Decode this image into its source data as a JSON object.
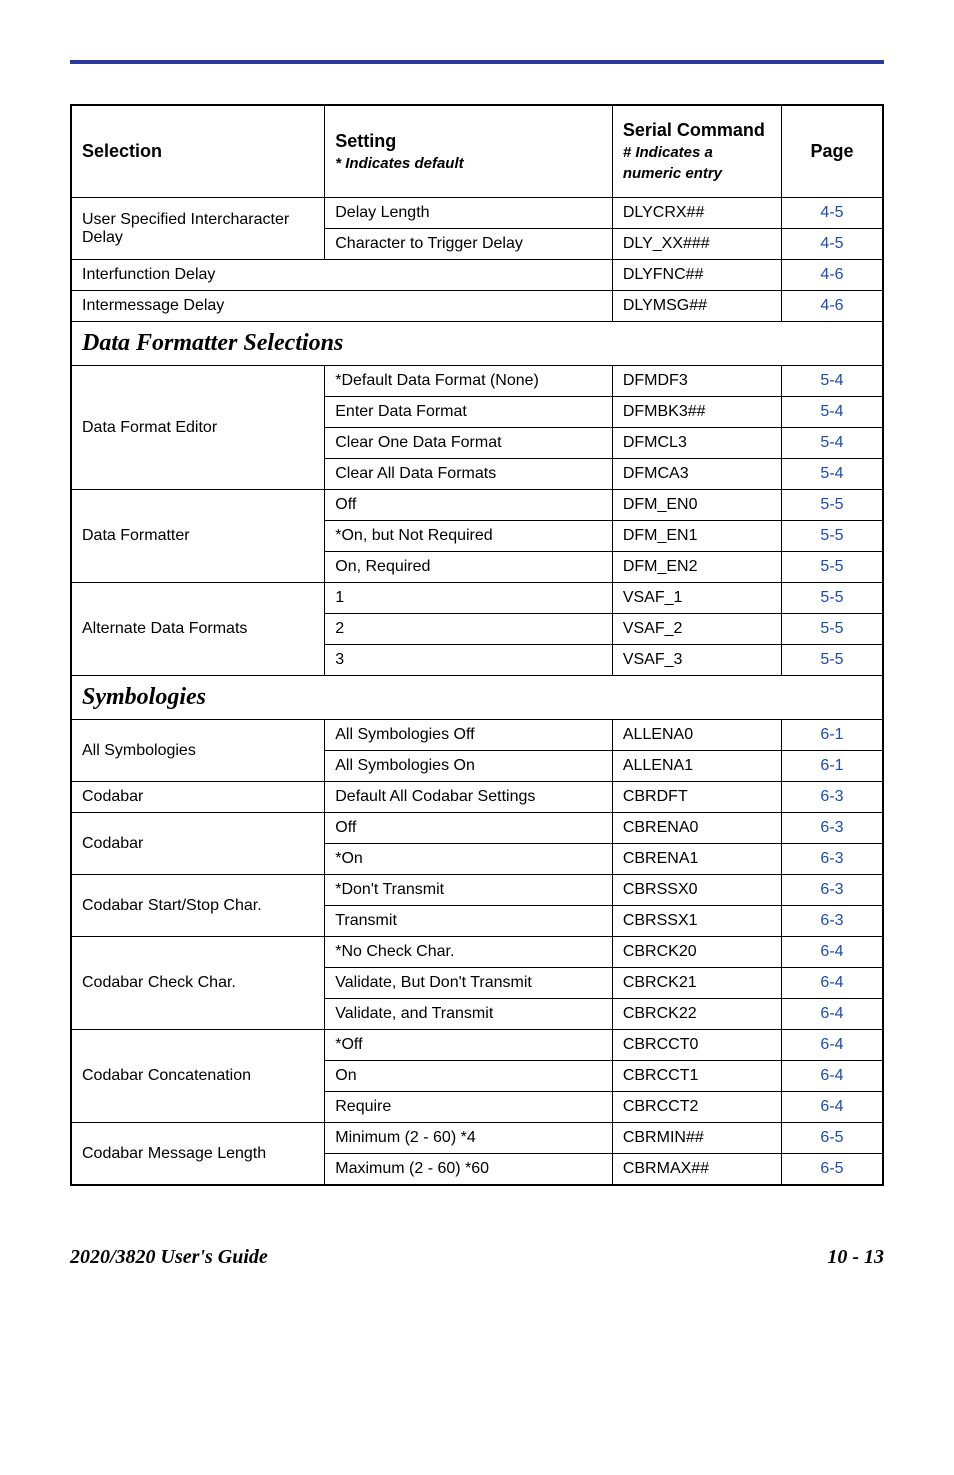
{
  "header": {
    "selection": "Selection",
    "setting": "Setting",
    "setting_sub": "* Indicates default",
    "serial": "Serial Command",
    "serial_sub": "# Indicates a numeric entry",
    "page": "Page"
  },
  "rows": [
    {
      "type": "row",
      "sel": "User Specified Intercharacter Delay",
      "sel_rowspan": 2,
      "set": "Delay Length",
      "cmd": "DLYCRX##",
      "page": "4-5"
    },
    {
      "type": "row",
      "set": "Character to Trigger Delay",
      "cmd": "DLY_XX###",
      "page": "4-5"
    },
    {
      "type": "row",
      "sel": "Interfunction Delay",
      "sel_colspan": 2,
      "cmd": "DLYFNC##",
      "page": "4-6"
    },
    {
      "type": "row",
      "sel": "Intermessage Delay",
      "sel_colspan": 2,
      "cmd": "DLYMSG##",
      "page": "4-6"
    },
    {
      "type": "section",
      "title": "Data Formatter Selections"
    },
    {
      "type": "row",
      "sel": "Data Format Editor",
      "sel_rowspan": 4,
      "set": "*Default Data Format (None)",
      "cmd": "DFMDF3",
      "page": "5-4"
    },
    {
      "type": "row",
      "set": "Enter Data Format",
      "cmd": "DFMBK3##",
      "page": "5-4"
    },
    {
      "type": "row",
      "set": "Clear One Data Format",
      "cmd": "DFMCL3",
      "page": "5-4"
    },
    {
      "type": "row",
      "set": "Clear All Data Formats",
      "cmd": "DFMCA3",
      "page": "5-4"
    },
    {
      "type": "row",
      "sel": "Data Formatter",
      "sel_rowspan": 3,
      "set": "Off",
      "cmd": "DFM_EN0",
      "page": "5-5"
    },
    {
      "type": "row",
      "set": "*On, but Not Required",
      "cmd": "DFM_EN1",
      "page": "5-5"
    },
    {
      "type": "row",
      "set": "On, Required",
      "cmd": "DFM_EN2",
      "page": "5-5"
    },
    {
      "type": "row",
      "sel": "Alternate Data Formats",
      "sel_rowspan": 3,
      "set": "1",
      "cmd": "VSAF_1",
      "page": "5-5"
    },
    {
      "type": "row",
      "set": "2",
      "cmd": "VSAF_2",
      "page": "5-5"
    },
    {
      "type": "row",
      "set": "3",
      "cmd": "VSAF_3",
      "page": "5-5"
    },
    {
      "type": "section",
      "title": "Symbologies"
    },
    {
      "type": "row",
      "sel": "All Symbologies",
      "sel_rowspan": 2,
      "set": "All Symbologies Off",
      "cmd": "ALLENA0",
      "page": "6-1"
    },
    {
      "type": "row",
      "set": "All Symbologies On",
      "cmd": "ALLENA1",
      "page": "6-1"
    },
    {
      "type": "row",
      "sel": "Codabar",
      "set": "Default All Codabar Settings",
      "cmd": "CBRDFT",
      "page": "6-3"
    },
    {
      "type": "row",
      "sel": "Codabar",
      "sel_rowspan": 2,
      "set": "Off",
      "cmd": "CBRENA0",
      "page": "6-3"
    },
    {
      "type": "row",
      "set": "*On",
      "cmd": "CBRENA1",
      "page": "6-3"
    },
    {
      "type": "row",
      "sel": "Codabar Start/Stop Char.",
      "sel_rowspan": 2,
      "set": "*Don't Transmit",
      "cmd": "CBRSSX0",
      "page": "6-3"
    },
    {
      "type": "row",
      "set": "Transmit",
      "cmd": "CBRSSX1",
      "page": "6-3"
    },
    {
      "type": "row",
      "sel": "Codabar Check Char.",
      "sel_rowspan": 3,
      "set": "*No Check Char.",
      "cmd": "CBRCK20",
      "page": "6-4"
    },
    {
      "type": "row",
      "set": "Validate, But Don't Transmit",
      "cmd": "CBRCK21",
      "page": "6-4"
    },
    {
      "type": "row",
      "set": "Validate, and Transmit",
      "cmd": "CBRCK22",
      "page": "6-4"
    },
    {
      "type": "row",
      "sel": "Codabar Concatenation",
      "sel_rowspan": 3,
      "set": "*Off",
      "cmd": "CBRCCT0",
      "page": "6-4"
    },
    {
      "type": "row",
      "set": "On",
      "cmd": "CBRCCT1",
      "page": "6-4"
    },
    {
      "type": "row",
      "set": "Require",
      "cmd": "CBRCCT2",
      "page": "6-4"
    },
    {
      "type": "row",
      "sel": "Codabar Message Length",
      "sel_rowspan": 2,
      "set": "Minimum (2 - 60)  *4",
      "cmd": "CBRMIN##",
      "page": "6-5"
    },
    {
      "type": "row",
      "set": "Maximum (2 - 60)  *60",
      "cmd": "CBRMAX##",
      "page": "6-5"
    }
  ],
  "footer": {
    "left": "2020/3820 User's Guide",
    "right": "10 - 13"
  }
}
